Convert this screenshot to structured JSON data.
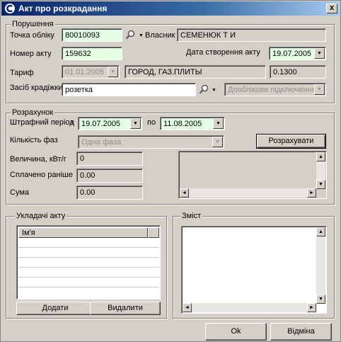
{
  "window": {
    "title": "Акт про розкрадання",
    "close": "x"
  },
  "violation": {
    "group_title": "Порушення",
    "meter_label": "Точка обліку",
    "meter_value": "80010093",
    "owner_label": "Власник",
    "owner_value": "СЕМЕНЮК Т И",
    "act_number_label": "Номер акту",
    "act_number_value": "159632",
    "created_label": "Дата створення акту",
    "created_value": "19.07.2005",
    "tariff_label": "Тариф",
    "tariff_date": "01.01.2005",
    "tariff_name": "ГОРОД, ГАЗ.ПЛИТЫ",
    "tariff_rate": "0.1300",
    "means_label": "Засіб крадіжки",
    "means_value": "розетка",
    "connection_value": "Дооблікове підключення"
  },
  "calc": {
    "group_title": "Розрахунок",
    "period_label": "Штрафний період",
    "from_label": "з",
    "from_value": "19.07.2005",
    "to_label": "по",
    "to_value": "11.08.2005",
    "phases_label": "Кількість фаз",
    "phases_value": "Одна фаза",
    "calc_button": "Розрахувати",
    "amount_label": "Величина, кВт/г",
    "amount_value": "0",
    "paid_label": "Сплачено раніше",
    "paid_value": "0.00",
    "sum_label": "Сума",
    "sum_value": "0.00"
  },
  "composers": {
    "group_title": "Укладачі акту",
    "column_name": "Ім'я",
    "add_button": "Додати",
    "delete_button": "Видалити"
  },
  "content": {
    "group_title": "Зміст"
  },
  "footer": {
    "ok_button": "Ok",
    "cancel_button": "Відміна"
  }
}
